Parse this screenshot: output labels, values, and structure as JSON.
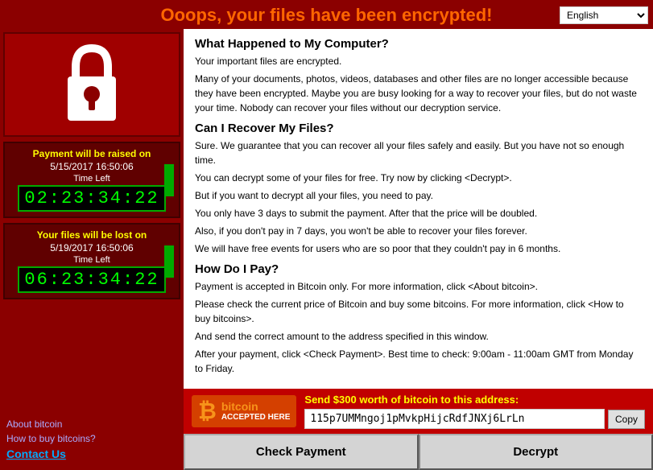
{
  "header": {
    "title": "Ooops, your files have been encrypted!",
    "language": "English"
  },
  "timer1": {
    "label": "Payment will be raised on",
    "date": "5/15/2017 16:50:06",
    "time_left_label": "Time Left",
    "time": "02:23:34:22"
  },
  "timer2": {
    "label": "Your files will be lost on",
    "date": "5/19/2017 16:50:06",
    "time_left_label": "Time Left",
    "time": "06:23:34:22"
  },
  "links": {
    "about_bitcoin": "About bitcoin",
    "how_to_buy": "How to buy bitcoins?",
    "contact_us": "Contact Us"
  },
  "content": {
    "section1_title": "What Happened to My Computer?",
    "section1_p1": "Your important files are encrypted.",
    "section1_p2": "Many of your documents, photos, videos, databases and other files are no longer accessible because they have been encrypted. Maybe you are busy looking for a way to recover your files, but do not waste your time. Nobody can recover your files without our decryption service.",
    "section2_title": "Can I Recover My Files?",
    "section2_p1": "Sure. We guarantee that you can recover all your files safely and easily. But you have not so enough time.",
    "section2_p2": "You can decrypt some of your files for free. Try now by clicking <Decrypt>.",
    "section2_p3": "But if you want to decrypt all your files, you need to pay.",
    "section2_p4": "You only have 3 days to submit the payment. After that the price will be doubled.",
    "section2_p5": "Also, if you don't pay in 7 days, you won't be able to recover your files forever.",
    "section2_p6": "We will have free events for users who are so poor that they couldn't pay in 6 months.",
    "section3_title": "How Do I Pay?",
    "section3_p1": "Payment is accepted in Bitcoin only. For more information, click <About bitcoin>.",
    "section3_p2": "Please check the current price of Bitcoin and buy some bitcoins. For more information, click <How to buy bitcoins>.",
    "section3_p3": "And send the correct amount to the address specified in this window.",
    "section3_p4": "After your payment, click <Check Payment>. Best time to check: 9:00am - 11:00am GMT from Monday to Friday."
  },
  "bitcoin": {
    "send_label": "Send $300 worth of bitcoin to this address:",
    "address": "115p7UMMngoj1pMvkpHijcRdfJNXj6LrLn",
    "copy_btn": "Copy",
    "logo_text": "bitcoin",
    "accepted_text": "ACCEPTED HERE"
  },
  "buttons": {
    "check_payment": "Check Payment",
    "decrypt": "Decrypt"
  }
}
